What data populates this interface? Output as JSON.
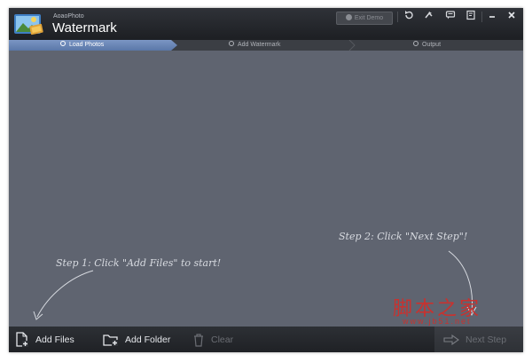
{
  "app": {
    "small_title": "AoaoPhoto",
    "title": "Watermark",
    "exit_label": "Exit Demo"
  },
  "titlebar_icons": [
    "undo-icon",
    "share-icon",
    "chat-icon",
    "register-icon",
    "minimize-icon",
    "close-icon"
  ],
  "steps": [
    {
      "label": "Load Photos",
      "active": true
    },
    {
      "label": "Add Watermark",
      "active": false
    },
    {
      "label": "Output",
      "active": false
    }
  ],
  "hints": {
    "step1": "Step 1: Click \"Add Files\" to start!",
    "step2": "Step 2: Click \"Next Step\"!"
  },
  "toolbar": {
    "add_files": "Add Files",
    "add_folder": "Add Folder",
    "clear": "Clear",
    "next_step": "Next Step"
  },
  "watermark": {
    "cn": "脚本之家",
    "url": "www.jb51.net"
  },
  "colors": {
    "accent": "#6a86b8",
    "workarea": "#5f6470",
    "watermark": "#c8322f"
  }
}
